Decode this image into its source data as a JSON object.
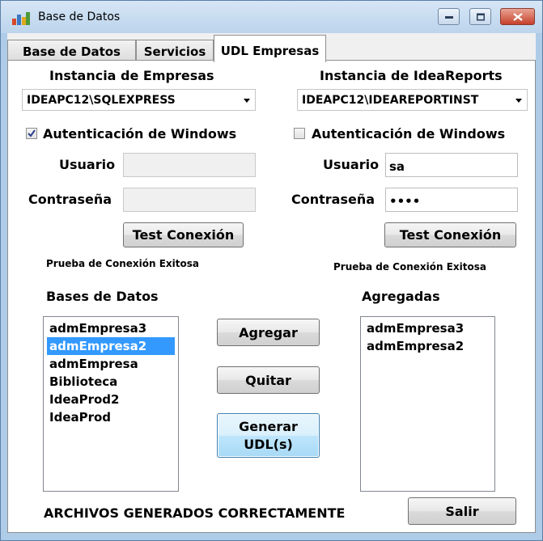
{
  "window": {
    "title": "Base de Datos"
  },
  "tabs": [
    {
      "label": "Base de Datos"
    },
    {
      "label": "Servicios"
    },
    {
      "label": "UDL Empresas"
    }
  ],
  "left": {
    "instance_label": "Instancia de Empresas",
    "instance_value": "IDEAPC12\\SQLEXPRESS",
    "windows_auth_label": "Autenticación de Windows",
    "windows_auth_checked": true,
    "user_label": "Usuario",
    "user_value": "",
    "password_label": "Contraseña",
    "password_value": "",
    "test_button": "Test Conexión",
    "status": "Prueba de Conexión Exitosa"
  },
  "right": {
    "instance_label": "Instancia de IdeaReports",
    "instance_value": "IDEAPC12\\IDEAREPORTINST",
    "windows_auth_label": "Autenticación de Windows",
    "windows_auth_checked": false,
    "user_label": "Usuario",
    "user_value": "sa",
    "password_label": "Contraseña",
    "password_value": "••••",
    "test_button": "Test Conexión",
    "status": "Prueba de Conexión Exitosa"
  },
  "databases": {
    "label": "Bases de  Datos",
    "items": [
      "admEmpresa3",
      "admEmpresa2",
      "admEmpresa",
      "Biblioteca",
      "IdeaProd2",
      "IdeaProd"
    ],
    "selected": "admEmpresa2"
  },
  "added": {
    "label": "Agregadas",
    "items": [
      "admEmpresa3",
      "admEmpresa2"
    ]
  },
  "buttons": {
    "add": "Agregar",
    "remove": "Quitar",
    "generate_line1": "Generar",
    "generate_line2": "UDL(s)",
    "exit": "Salir"
  },
  "footer_status": "ARCHIVOS GENERADOS CORRECTAMENTE",
  "icons": {
    "app": "database-app-icon",
    "combo_arrow": "chevron-down-icon",
    "checkmark": "checkmark-icon"
  }
}
